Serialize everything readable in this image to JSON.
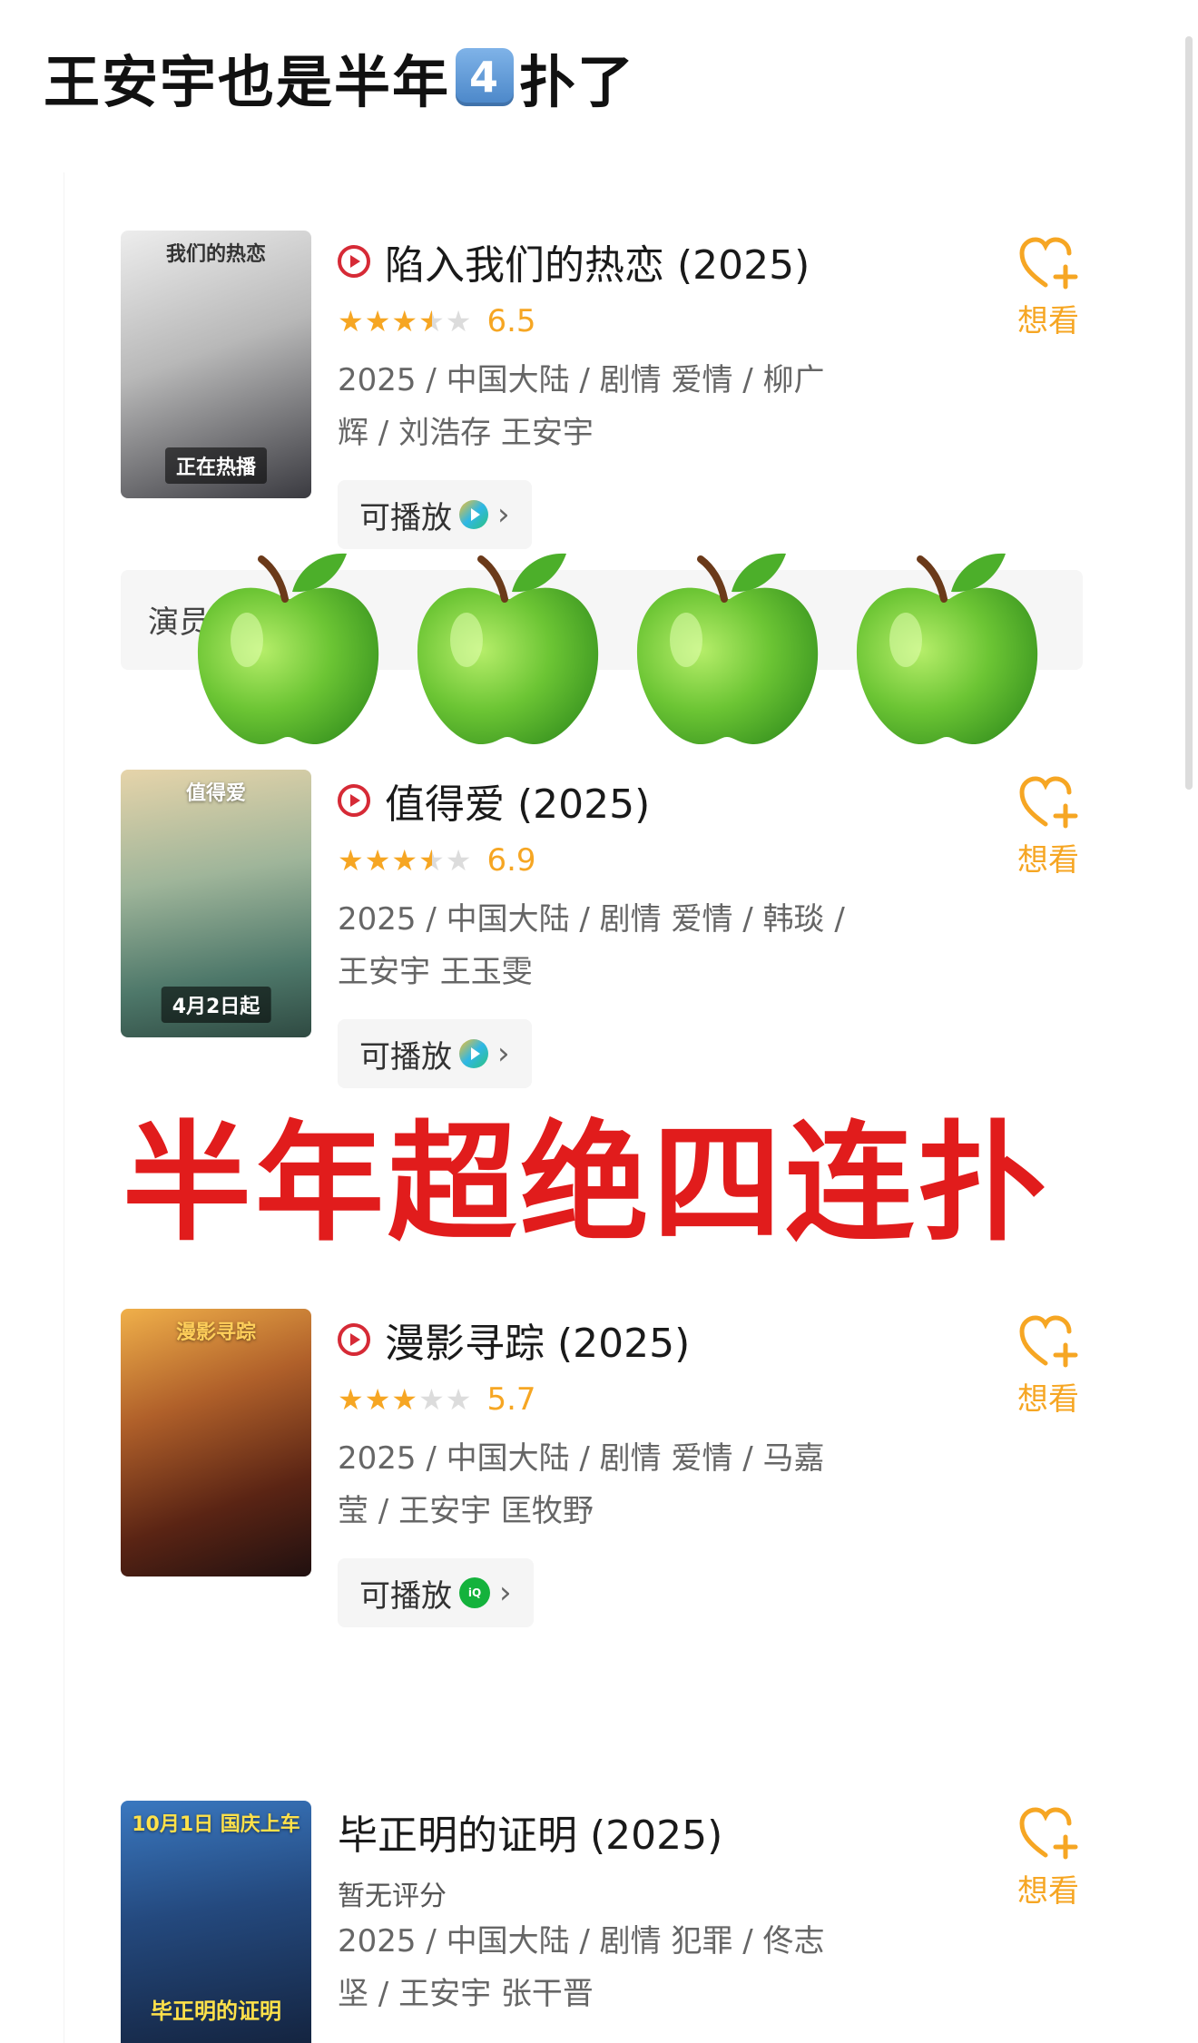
{
  "post": {
    "title_before": "王安宇也是半年",
    "title_keycap": "4",
    "title_after": "扑了"
  },
  "movies": [
    {
      "title": "陷入我们的热恋 (2025)",
      "has_play_icon": true,
      "rating_stars": 3.5,
      "score": "6.5",
      "meta_line1": "2025 / 中国大陆 / 剧情 爱情 / 柳广",
      "meta_line2": "辉 / 刘浩存 王安宇",
      "play_label": "可播放",
      "platform": "tencent-video",
      "want_label": "想看",
      "poster": {
        "top_text": "我们的热恋",
        "tag": "正在热播",
        "colors": [
          "#e9e9e9",
          "#9a9a9a",
          "#2c2c30"
        ]
      }
    },
    {
      "title": "值得爱 (2025)",
      "has_play_icon": true,
      "rating_stars": 3.5,
      "score": "6.9",
      "meta_line1": "2025 / 中国大陆 / 剧情 爱情 / 韩琰 /",
      "meta_line2": "王安宇 王玉雯",
      "play_label": "可播放",
      "platform": "tencent-video",
      "want_label": "想看",
      "poster": {
        "top_text": "值得爱",
        "tag": "4月2日起",
        "colors": [
          "#d9c9a4",
          "#7aa08e",
          "#3c5c54"
        ]
      }
    },
    {
      "title": "漫影寻踪 (2025)",
      "has_play_icon": true,
      "rating_stars": 3,
      "score": "5.7",
      "meta_line1": "2025 / 中国大陆 / 剧情 爱情 / 马嘉",
      "meta_line2": "莹 / 王安宇 匡牧野",
      "play_label": "可播放",
      "platform": "iqiyi",
      "want_label": "想看",
      "poster": {
        "top_text": "漫影寻踪",
        "tag": "",
        "colors": [
          "#e0a040",
          "#8a3a1c",
          "#2a1410"
        ]
      }
    },
    {
      "title": "毕正明的证明 (2025)",
      "has_play_icon": false,
      "rating_text": "暂无评分",
      "meta_line1": "2025 / 中国大陆 / 剧情 犯罪 / 佟志",
      "meta_line2": "坚 / 王安宇 张干晋",
      "want_label": "想看",
      "poster": {
        "top_text": "10月1日 国庆上车",
        "tag": "毕正明的证明",
        "colors": [
          "#2a5a9a",
          "#1c3460",
          "#101a2c"
        ]
      }
    }
  ],
  "cast_bar": {
    "label": "演员"
  },
  "overlay": {
    "apple_count": 4,
    "banner_text": "半年超绝四连扑"
  },
  "colors": {
    "accent_orange": "#f6a623",
    "play_red": "#d62a36",
    "banner_red": "#e11c1c",
    "apple_green": "#7ccf3a"
  },
  "icons": [
    "play-circle-icon",
    "star-icon",
    "heart-plus-icon",
    "tencent-video-icon",
    "iqiyi-icon",
    "chevron-right-icon",
    "green-apple-icon"
  ]
}
